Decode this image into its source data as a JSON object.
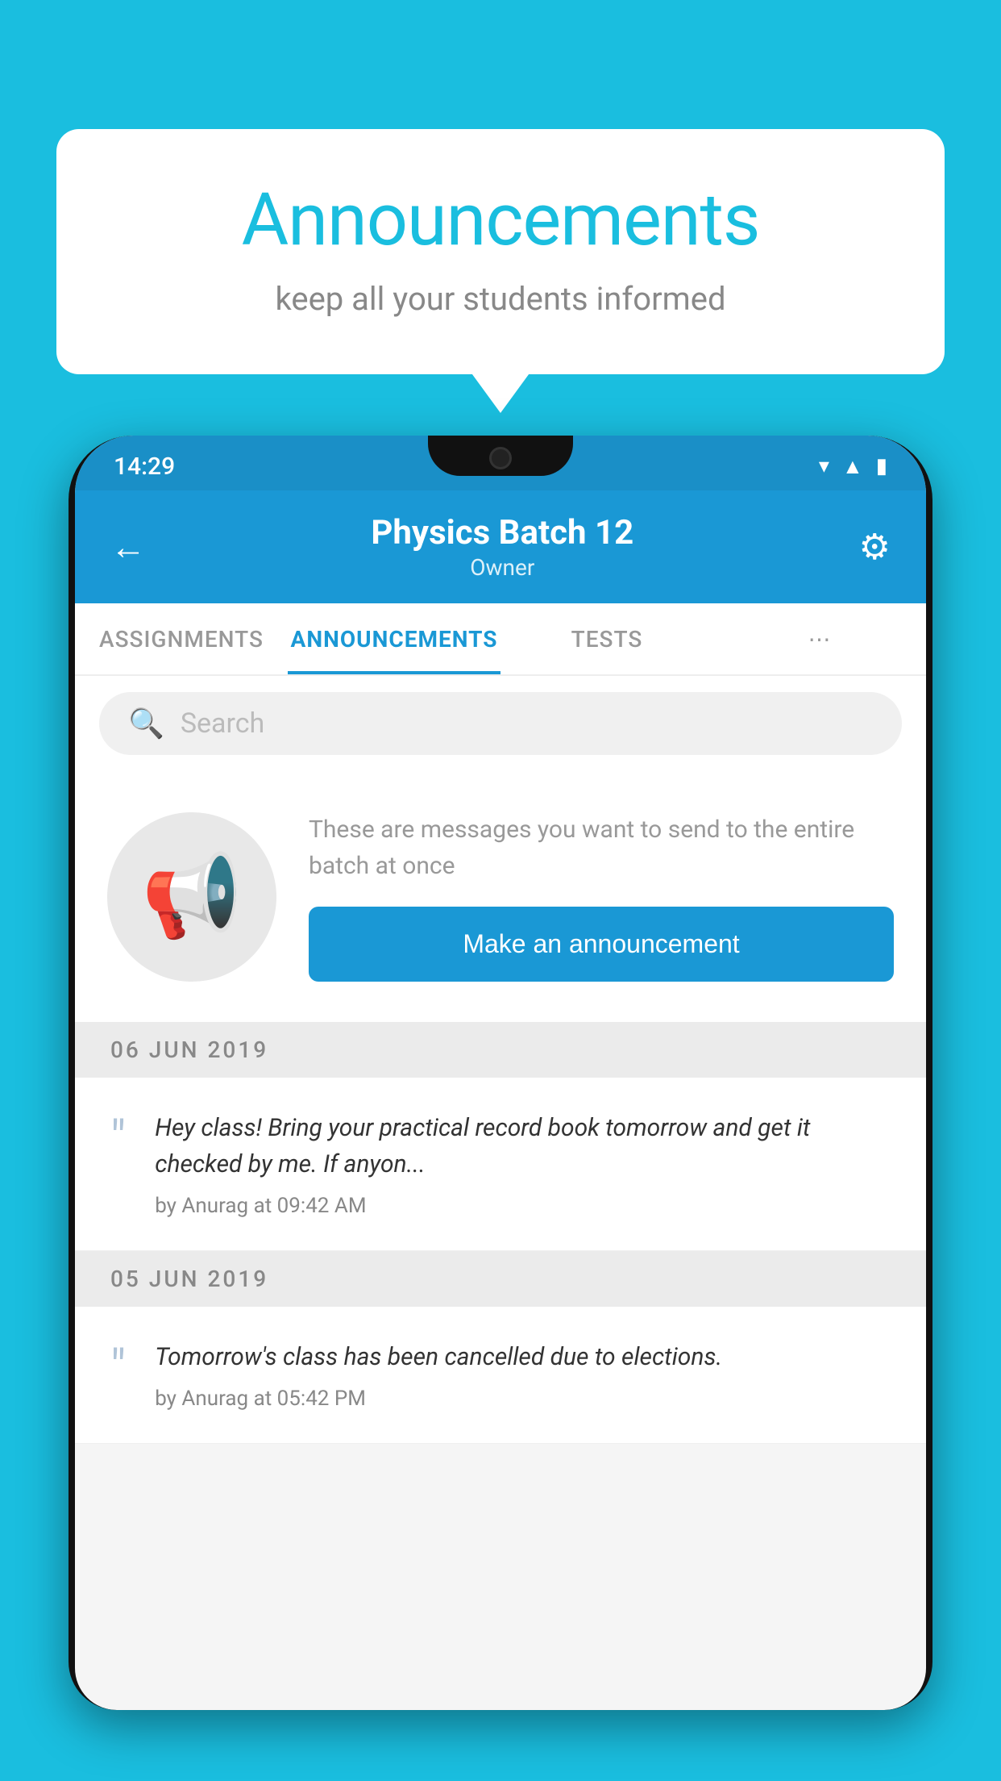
{
  "background_color": "#1ABEDF",
  "speech_bubble": {
    "title": "Announcements",
    "subtitle": "keep all your students informed"
  },
  "phone": {
    "status_bar": {
      "time": "14:29",
      "icons": [
        "wifi",
        "signal",
        "battery"
      ]
    },
    "header": {
      "back_label": "←",
      "title": "Physics Batch 12",
      "subtitle": "Owner",
      "gear_label": "⚙"
    },
    "tabs": [
      {
        "label": "ASSIGNMENTS",
        "active": false
      },
      {
        "label": "ANNOUNCEMENTS",
        "active": true
      },
      {
        "label": "TESTS",
        "active": false
      },
      {
        "label": "⋯",
        "active": false
      }
    ],
    "search": {
      "placeholder": "Search"
    },
    "placeholder_card": {
      "description": "These are messages you want to send to the entire batch at once",
      "button_label": "Make an announcement"
    },
    "announcements": [
      {
        "date": "06  JUN  2019",
        "message": "Hey class! Bring your practical record book tomorrow and get it checked by me. If anyon...",
        "meta": "by Anurag at 09:42 AM"
      },
      {
        "date": "05  JUN  2019",
        "message": "Tomorrow's class has been cancelled due to elections.",
        "meta": "by Anurag at 05:42 PM"
      }
    ]
  }
}
